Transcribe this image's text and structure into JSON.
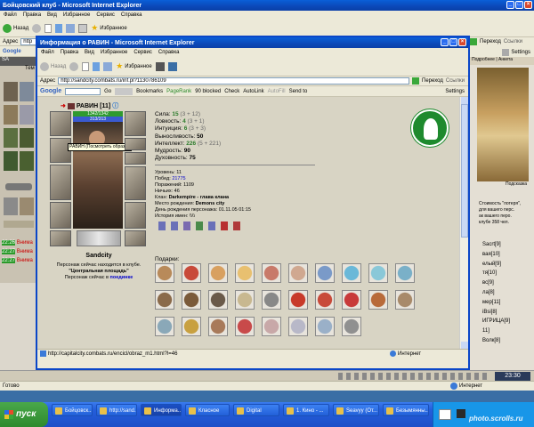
{
  "back_window": {
    "title": "Бойцовский клуб - Microsoft Internet Explorer",
    "menu": [
      "Файл",
      "Правка",
      "Вид",
      "Избранное",
      "Сервис",
      "Справка"
    ],
    "back_label": "Назад",
    "favorites_label": "Избранное",
    "address_label": "Адрес",
    "go_label": "Переход",
    "links_label": "Ссылки",
    "settings_label": "Settings",
    "chat_lines": [
      {
        "time": "22:26",
        "text": "Внима"
      },
      {
        "time": "22:27",
        "text": "Внима"
      },
      {
        "time": "22:27",
        "text": "Внима"
      }
    ],
    "right_panel": {
      "tabs": "Подробнее | Анкета",
      "caption": "Подсказка",
      "text_lines": [
        "Стоимость \"потеря\",",
        "для вашего перс.",
        "ак вашего перо.",
        "клубе 358 чел."
      ],
      "names": [
        "Sacrt[9]",
        "вая[10]",
        "елый[9]",
        "тя[10]",
        "вс[9]",
        "ла[8]",
        "мер[11]",
        "iBsi[8]",
        "ИГРИЦА[9]",
        "11]",
        "Волк[8]"
      ]
    },
    "status_text": "Готово",
    "status_zone": "Интернет",
    "clock": "23:30"
  },
  "front_window": {
    "title": "Информация о РАВИН - Microsoft Internet Explorer",
    "menu": [
      "Файл",
      "Правка",
      "Вид",
      "Избранное",
      "Сервис",
      "Справка"
    ],
    "back_label": "Назад",
    "favorites_label": "Избранное",
    "address_label": "Адрес",
    "url": "http://sandcity.combats.ru/inf.pl?1130786109",
    "go_label": "Переход",
    "links_label": "Ссылки",
    "google_toolbar": {
      "search_button": "Go",
      "bookmarks": "Bookmarks",
      "pagerank": "PageRank",
      "blocked": "90 blocked",
      "check": "Check",
      "autolink": "AutoLink",
      "autofill": "AutoFill",
      "send_to": "Send to",
      "settings": "Settings"
    },
    "status_url": "http://capitalcity.combats.ru/encicl/obraz_m1.html?l=46",
    "status_zone": "Интернет"
  },
  "character": {
    "name": "РАВИН",
    "level": "[11]",
    "hp_text": "1342/1342",
    "mana_text": "313/313",
    "tooltip": "РАВИН (Посмотреть образ)",
    "city": "Sandcity",
    "location_text": "Персонаж сейчас находится в клубе.",
    "location_name": "\"Центральная площадь\"",
    "fight_prefix": "Персонаж сейчас в",
    "fight_link": "поединке",
    "stats": [
      {
        "label": "Сила:",
        "value": "15",
        "extra": "(3 + 12)"
      },
      {
        "label": "Ловкость:",
        "value": "4",
        "extra": "(3 + 1)"
      },
      {
        "label": "Интуиция:",
        "value": "6",
        "extra": "(3 + 3)"
      },
      {
        "label": "Выносливость:",
        "value": "50",
        "extra": ""
      },
      {
        "label": "Интеллект:",
        "value": "226",
        "extra": "(5 + 221)"
      },
      {
        "label": "Мудрость:",
        "value": "90",
        "extra": ""
      },
      {
        "label": "Духовность:",
        "value": "75",
        "extra": ""
      }
    ],
    "info": [
      {
        "label": "Уровень:",
        "value": "11"
      },
      {
        "label": "Побед:",
        "value": "21775"
      },
      {
        "label": "Поражений:",
        "value": "1109"
      },
      {
        "label": "Ничьих:",
        "value": "46"
      },
      {
        "label": "Клан:",
        "value": "Darkempire - глава клана"
      },
      {
        "label": "Место рождения:",
        "value": "Demons city"
      },
      {
        "label": "День рождения персонажа:",
        "value": "01.11.05 01:15"
      },
      {
        "label": "История имен:",
        "value": "\\\\\\\\"
      }
    ],
    "gifts_label": "Подарки:",
    "colors": {
      "hp": "#2f9a2f",
      "mana": "#3a5ad0",
      "clan_logo": "#1e8a2e"
    }
  },
  "taskbar": {
    "start_label": "пуск",
    "tasks": [
      "Бойцовск...",
      "http://sand...",
      "Информа...",
      "Класное",
      "Digital",
      "1. Кино - ...",
      "Seavyy (От...",
      "Безымянны..."
    ],
    "watermark": "photo.scrolls.ru"
  }
}
